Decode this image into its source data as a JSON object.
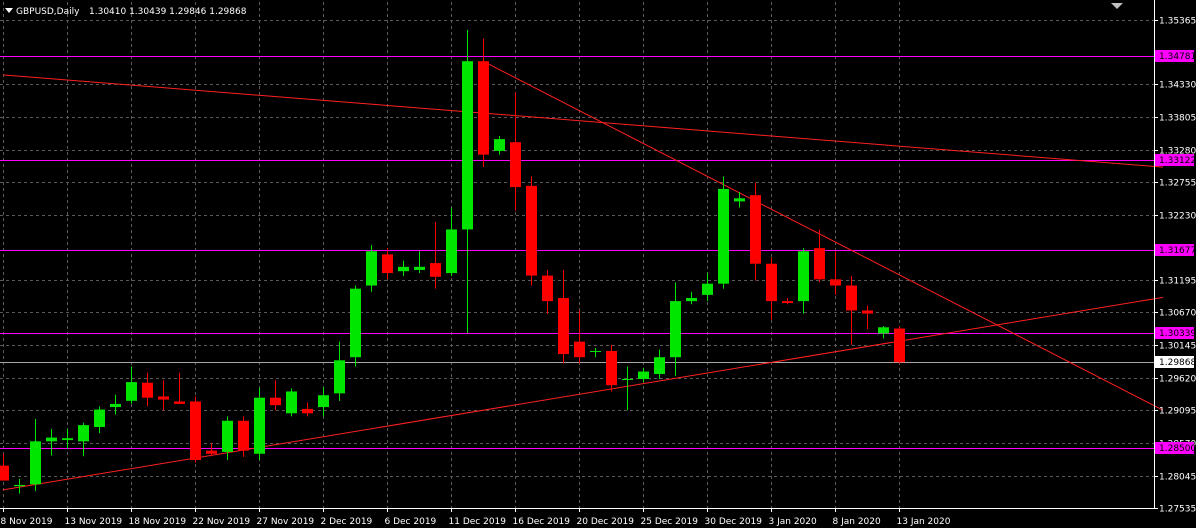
{
  "header": {
    "symbol": "GBPUSD,Daily",
    "ohlc": "1.30410 1.30439 1.29846 1.29868"
  },
  "colors": {
    "background": "#000000",
    "grid": "#5a5a5a",
    "bull": "#00e600",
    "bear": "#ff0000",
    "level": "#ff00ff",
    "trend": "#ff2020",
    "text": "#ffffff"
  },
  "chart_data": {
    "type": "candlestick",
    "ylim": [
      1.2753,
      1.3565
    ],
    "y_ticks": [
      "1.35365",
      "1.34330",
      "1.33805",
      "1.33280",
      "1.32755",
      "1.32230",
      "1.31195",
      "1.30670",
      "1.30145",
      "1.29620",
      "1.29095",
      "1.28570",
      "1.28045",
      "1.27535"
    ],
    "x_ticks": [
      "8 Nov 2019",
      "13 Nov 2019",
      "18 Nov 2019",
      "22 Nov 2019",
      "27 Nov 2019",
      "2 Dec 2019",
      "6 Dec 2019",
      "11 Dec 2019",
      "16 Dec 2019",
      "20 Dec 2019",
      "25 Dec 2019",
      "30 Dec 2019",
      "3 Jan 2020",
      "8 Jan 2020",
      "13 Jan 2020"
    ],
    "levels": [
      "1.34781",
      "1.33122",
      "1.31677",
      "1.30339",
      "1.28500"
    ],
    "current_price": "1.29868",
    "candles": [
      {
        "o": 1.2821,
        "h": 1.284,
        "l": 1.28,
        "c": 1.2797
      },
      {
        "o": 1.2788,
        "h": 1.28,
        "l": 1.2776,
        "c": 1.279
      },
      {
        "o": 1.2791,
        "h": 1.2896,
        "l": 1.278,
        "c": 1.286
      },
      {
        "o": 1.286,
        "h": 1.288,
        "l": 1.2837,
        "c": 1.2866
      },
      {
        "o": 1.2862,
        "h": 1.288,
        "l": 1.2848,
        "c": 1.2865
      },
      {
        "o": 1.286,
        "h": 1.289,
        "l": 1.2836,
        "c": 1.2886
      },
      {
        "o": 1.2883,
        "h": 1.2916,
        "l": 1.2873,
        "c": 1.2911
      },
      {
        "o": 1.2915,
        "h": 1.2935,
        "l": 1.2903,
        "c": 1.292
      },
      {
        "o": 1.2925,
        "h": 1.298,
        "l": 1.292,
        "c": 1.2955
      },
      {
        "o": 1.2954,
        "h": 1.297,
        "l": 1.2916,
        "c": 1.293
      },
      {
        "o": 1.2932,
        "h": 1.2958,
        "l": 1.291,
        "c": 1.2927
      },
      {
        "o": 1.2924,
        "h": 1.297,
        "l": 1.292,
        "c": 1.292
      },
      {
        "o": 1.2924,
        "h": 1.2932,
        "l": 1.2826,
        "c": 1.283
      },
      {
        "o": 1.2845,
        "h": 1.2857,
        "l": 1.2836,
        "c": 1.284
      },
      {
        "o": 1.2843,
        "h": 1.29,
        "l": 1.283,
        "c": 1.2893
      },
      {
        "o": 1.2893,
        "h": 1.29,
        "l": 1.2835,
        "c": 1.2845
      },
      {
        "o": 1.284,
        "h": 1.2946,
        "l": 1.283,
        "c": 1.293
      },
      {
        "o": 1.293,
        "h": 1.2958,
        "l": 1.291,
        "c": 1.2918
      },
      {
        "o": 1.2905,
        "h": 1.2945,
        "l": 1.29,
        "c": 1.294
      },
      {
        "o": 1.2912,
        "h": 1.2922,
        "l": 1.29,
        "c": 1.2905
      },
      {
        "o": 1.2915,
        "h": 1.2947,
        "l": 1.29,
        "c": 1.2934
      },
      {
        "o": 1.2937,
        "h": 1.302,
        "l": 1.2925,
        "c": 1.299
      },
      {
        "o": 1.2995,
        "h": 1.311,
        "l": 1.298,
        "c": 1.3105
      },
      {
        "o": 1.311,
        "h": 1.3175,
        "l": 1.31,
        "c": 1.3165
      },
      {
        "o": 1.316,
        "h": 1.317,
        "l": 1.312,
        "c": 1.313
      },
      {
        "o": 1.3133,
        "h": 1.315,
        "l": 1.3125,
        "c": 1.314
      },
      {
        "o": 1.3135,
        "h": 1.3165,
        "l": 1.313,
        "c": 1.314
      },
      {
        "o": 1.3146,
        "h": 1.3212,
        "l": 1.3105,
        "c": 1.3124
      },
      {
        "o": 1.313,
        "h": 1.3235,
        "l": 1.3125,
        "c": 1.32
      },
      {
        "o": 1.32,
        "h": 1.352,
        "l": 1.3034,
        "c": 1.347
      },
      {
        "o": 1.347,
        "h": 1.3506,
        "l": 1.33,
        "c": 1.332
      },
      {
        "o": 1.3326,
        "h": 1.335,
        "l": 1.332,
        "c": 1.3345
      },
      {
        "o": 1.334,
        "h": 1.342,
        "l": 1.323,
        "c": 1.3268
      },
      {
        "o": 1.327,
        "h": 1.3285,
        "l": 1.311,
        "c": 1.3126
      },
      {
        "o": 1.3126,
        "h": 1.3135,
        "l": 1.3065,
        "c": 1.3085
      },
      {
        "o": 1.309,
        "h": 1.3135,
        "l": 1.2985,
        "c": 1.3
      },
      {
        "o": 1.302,
        "h": 1.307,
        "l": 1.2985,
        "c": 1.2995
      },
      {
        "o": 1.3004,
        "h": 1.301,
        "l": 1.2995,
        "c": 1.3005
      },
      {
        "o": 1.3005,
        "h": 1.3015,
        "l": 1.294,
        "c": 1.295
      },
      {
        "o": 1.296,
        "h": 1.298,
        "l": 1.291,
        "c": 1.296
      },
      {
        "o": 1.296,
        "h": 1.2978,
        "l": 1.2955,
        "c": 1.2972
      },
      {
        "o": 1.2968,
        "h": 1.3007,
        "l": 1.296,
        "c": 1.2995
      },
      {
        "o": 1.2995,
        "h": 1.3115,
        "l": 1.2965,
        "c": 1.3085
      },
      {
        "o": 1.3085,
        "h": 1.31,
        "l": 1.308,
        "c": 1.309
      },
      {
        "o": 1.3095,
        "h": 1.313,
        "l": 1.3085,
        "c": 1.3113
      },
      {
        "o": 1.3113,
        "h": 1.3285,
        "l": 1.3105,
        "c": 1.3265
      },
      {
        "o": 1.3245,
        "h": 1.326,
        "l": 1.3235,
        "c": 1.325
      },
      {
        "o": 1.3255,
        "h": 1.3275,
        "l": 1.3118,
        "c": 1.3145
      },
      {
        "o": 1.3145,
        "h": 1.3155,
        "l": 1.3055,
        "c": 1.3085
      },
      {
        "o": 1.3085,
        "h": 1.309,
        "l": 1.308,
        "c": 1.3082
      },
      {
        "o": 1.3085,
        "h": 1.317,
        "l": 1.3065,
        "c": 1.3165
      },
      {
        "o": 1.317,
        "h": 1.32,
        "l": 1.3115,
        "c": 1.312
      },
      {
        "o": 1.312,
        "h": 1.3165,
        "l": 1.3095,
        "c": 1.311
      },
      {
        "o": 1.311,
        "h": 1.3125,
        "l": 1.3015,
        "c": 1.307
      },
      {
        "o": 1.307,
        "h": 1.3078,
        "l": 1.304,
        "c": 1.3065
      },
      {
        "o": 1.3033,
        "h": 1.3045,
        "l": 1.3025,
        "c": 1.3043
      },
      {
        "o": 1.3041,
        "h": 1.3044,
        "l": 1.2985,
        "c": 1.2987
      }
    ],
    "trendlines": [
      {
        "x1": 0,
        "y1": 1.2782,
        "x2": 72.5,
        "y2": 1.3091
      },
      {
        "x1": 30,
        "y1": 1.347,
        "x2": 72.5,
        "y2": 1.291
      },
      {
        "x1": 0,
        "y1": 1.3448,
        "x2": 72.5,
        "y2": 1.33
      }
    ]
  }
}
